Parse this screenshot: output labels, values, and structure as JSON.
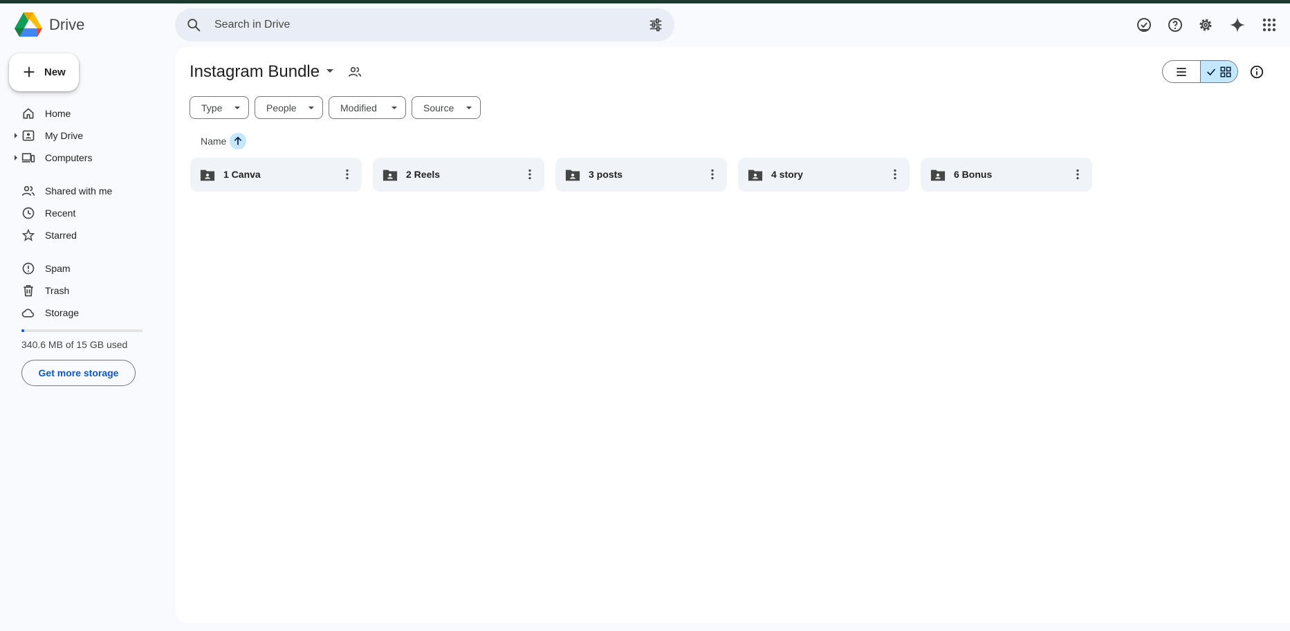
{
  "app": {
    "name": "Drive",
    "logo_icon": "google-drive-logo"
  },
  "header": {
    "search_placeholder": "Search in Drive",
    "icons": [
      "offline-ready-icon",
      "help-icon",
      "settings-icon",
      "gemini-icon",
      "apps-icon"
    ]
  },
  "new_button": {
    "label": "New"
  },
  "sidebar": {
    "items": [
      {
        "label": "Home",
        "icon": "home-icon"
      },
      {
        "label": "My Drive",
        "icon": "my-drive-icon"
      },
      {
        "label": "Computers",
        "icon": "computers-icon"
      },
      {
        "label": "Shared with me",
        "icon": "shared-icon"
      },
      {
        "label": "Recent",
        "icon": "clock-icon"
      },
      {
        "label": "Starred",
        "icon": "star-icon"
      },
      {
        "label": "Spam",
        "icon": "spam-icon"
      },
      {
        "label": "Trash",
        "icon": "trash-icon"
      },
      {
        "label": "Storage",
        "icon": "cloud-icon"
      }
    ],
    "storage_used_fraction": 0.023,
    "storage_text": "340.6 MB of 15 GB used",
    "get_storage_label": "Get more storage"
  },
  "main": {
    "folder_title": "Instagram Bundle",
    "filters": [
      "Type",
      "People",
      "Modified",
      "Source"
    ],
    "sort_label": "Name",
    "view_mode": "grid",
    "folders": [
      {
        "name": "1 Canva"
      },
      {
        "name": "2 Reels"
      },
      {
        "name": "3 posts"
      },
      {
        "name": "4 story"
      },
      {
        "name": "6 Bonus"
      }
    ]
  },
  "colors": {
    "accent": "#0b57d0",
    "selected_bg": "#c2e7ff",
    "background": "#f8fafd",
    "card_bg": "#f0f4f9"
  }
}
